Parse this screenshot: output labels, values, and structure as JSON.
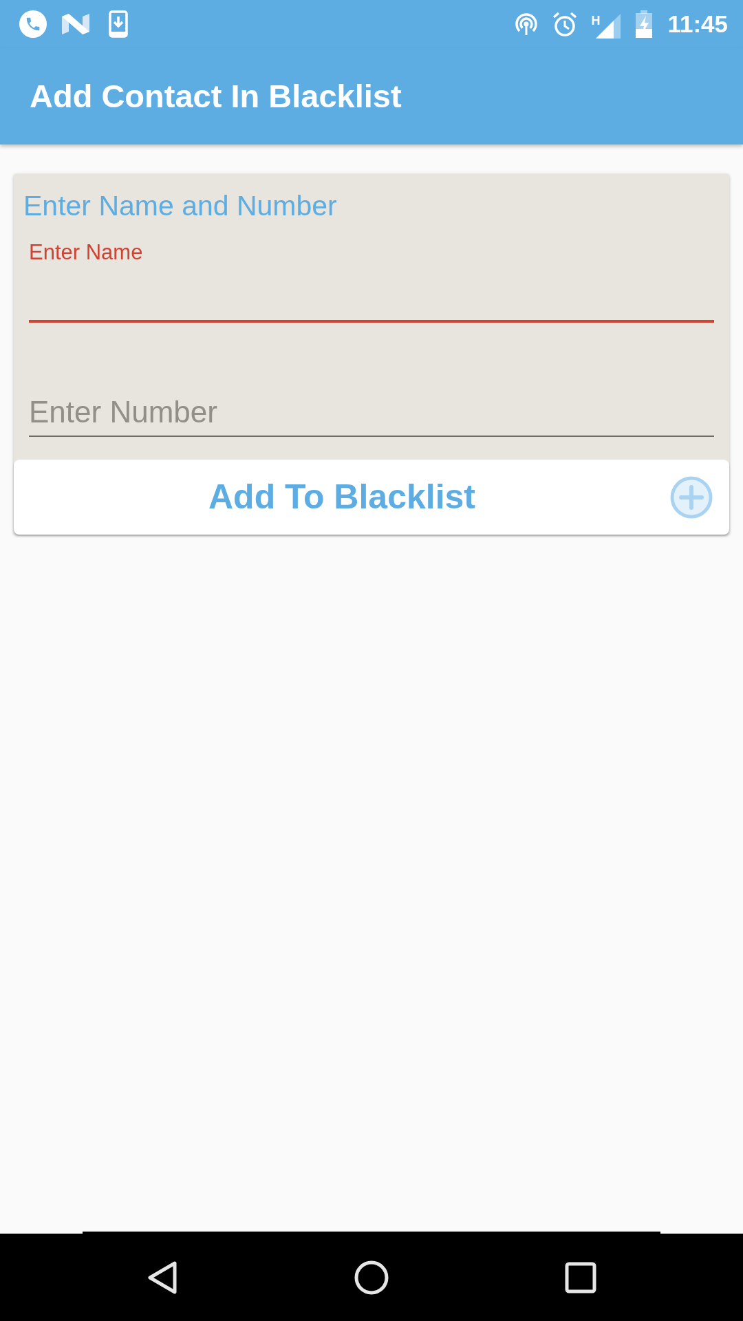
{
  "status_bar": {
    "network_type": "H",
    "time": "11:45"
  },
  "app_bar": {
    "title": "Add Contact In Blacklist"
  },
  "form": {
    "title": "Enter Name and Number",
    "fields": [
      {
        "placeholder": "Enter Name",
        "focused": true
      },
      {
        "placeholder": "Enter Number",
        "focused": false
      }
    ],
    "button": {
      "label": "Add To Blacklist"
    }
  }
}
